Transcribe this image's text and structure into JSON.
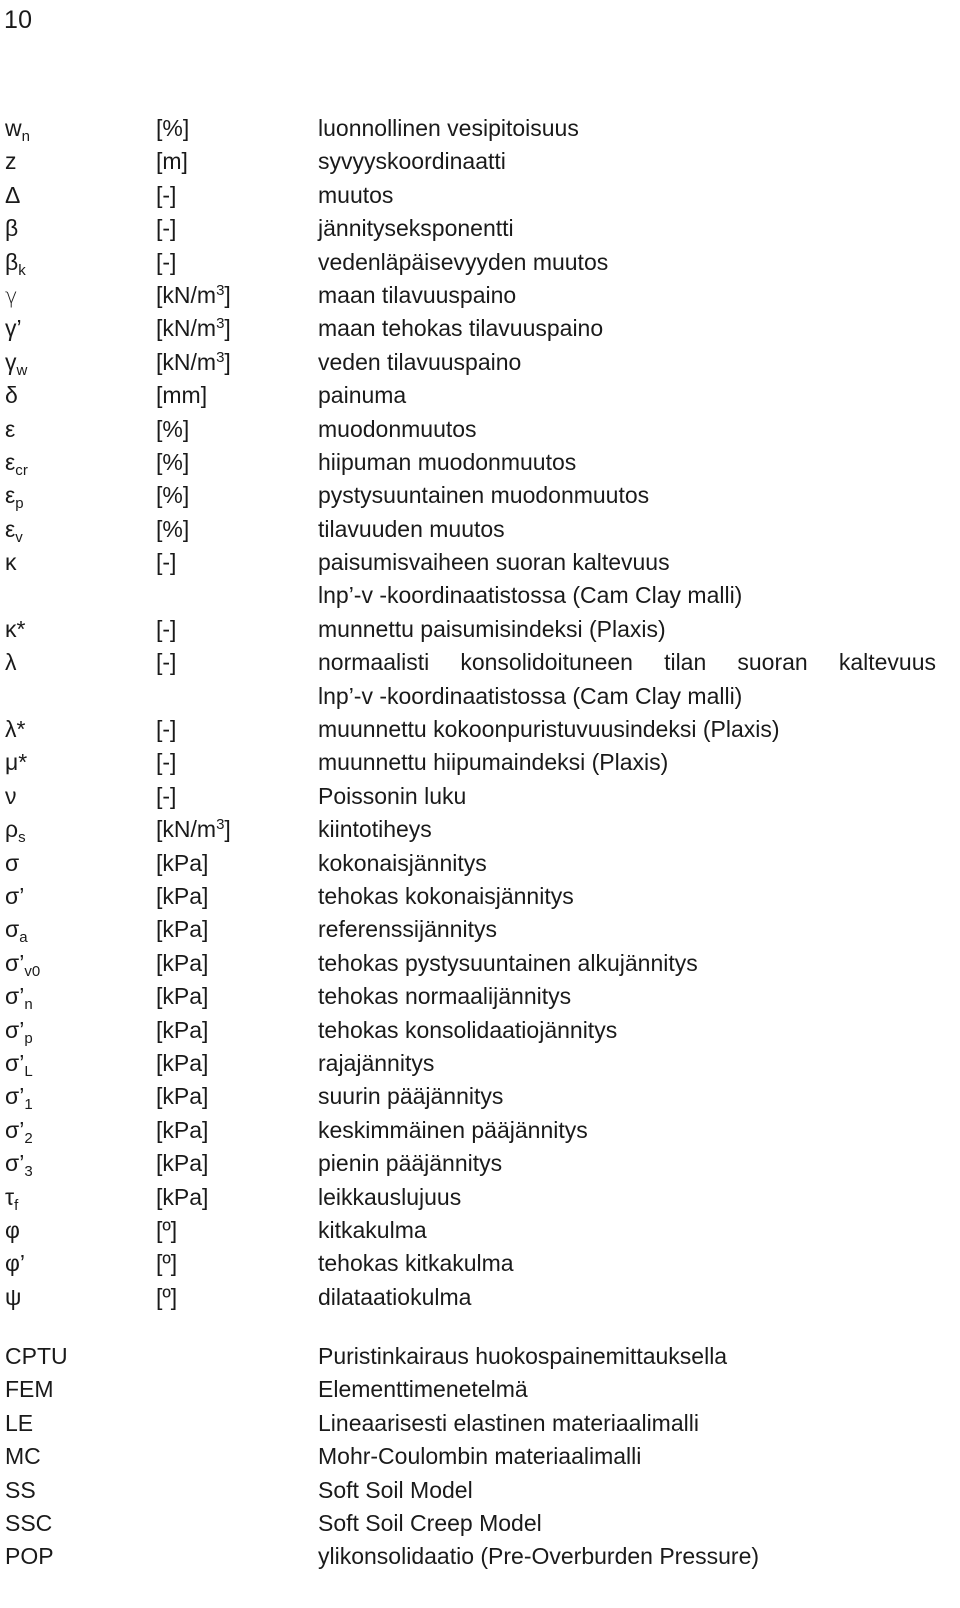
{
  "page": {
    "number": "10"
  },
  "symbols": [
    {
      "symbol": "w",
      "sub": "n",
      "unit": "[%]",
      "desc": "luonnollinen vesipitoisuus"
    },
    {
      "symbol": "z",
      "sub": "",
      "unit": "[m]",
      "desc": "syvyyskoordinaatti"
    },
    {
      "symbol": "Δ",
      "sub": "",
      "unit": "[-]",
      "desc": "muutos"
    },
    {
      "symbol": "β",
      "sub": "",
      "unit": "[-]",
      "desc": "jännityseksponentti"
    },
    {
      "symbol": "β",
      "sub": "k",
      "unit": "[-]",
      "desc": "vedenläpäisevyyden muutos"
    },
    {
      "symbol": "γ",
      "sub": "",
      "unit": "[kN/m³]",
      "desc": "maan tilavuuspaino",
      "style": "thin"
    },
    {
      "symbol": "γ’",
      "sub": "",
      "unit": "[kN/m³]",
      "desc": "maan tehokas tilavuuspaino"
    },
    {
      "symbol": "γ",
      "sub": "w",
      "unit": "[kN/m³]",
      "desc": "veden tilavuuspaino"
    },
    {
      "symbol": "δ",
      "sub": "",
      "unit": "[mm]",
      "desc": "painuma"
    },
    {
      "symbol": "ε",
      "sub": "",
      "unit": "[%]",
      "desc": "muodonmuutos"
    },
    {
      "symbol": "ε",
      "sub": "cr",
      "unit": "[%]",
      "desc": "hiipuman muodonmuutos"
    },
    {
      "symbol": "ε",
      "sub": "p",
      "unit": "[%]",
      "desc": "pystysuuntainen muodonmuutos"
    },
    {
      "symbol": "ε",
      "sub": "v",
      "unit": "[%]",
      "desc": "tilavuuden muutos"
    },
    {
      "symbol": "κ",
      "sub": "",
      "unit": "[-]",
      "desc": "paisumisvaiheen suoran kaltevuus"
    },
    {
      "symbol": "",
      "sub": "",
      "unit": "",
      "desc": "lnp’-v -koordinaatistossa (Cam Clay malli)"
    },
    {
      "symbol": "κ*",
      "sub": "",
      "unit": "[-]",
      "desc": "munnettu paisumisindeksi (Plaxis)"
    },
    {
      "symbol": "λ",
      "sub": "",
      "unit": "[-]",
      "desc": "normaalisti konsolidoituneen tilan suoran kaltevuus",
      "justify": true
    },
    {
      "symbol": "",
      "sub": "",
      "unit": "",
      "desc": "lnp’-v -koordinaatistossa (Cam Clay malli)"
    },
    {
      "symbol": "λ*",
      "sub": "",
      "unit": "[-]",
      "desc": "muunnettu kokoonpuristuvuusindeksi (Plaxis)"
    },
    {
      "symbol": "μ*",
      "sub": "",
      "unit": "[-]",
      "desc": "muunnettu hiipumaindeksi (Plaxis)"
    },
    {
      "symbol": "ν",
      "sub": "",
      "unit": "[-]",
      "desc": "Poissonin luku"
    },
    {
      "symbol": "ρ",
      "sub": "s",
      "unit": "[kN/m³]",
      "desc": "kiintotiheys"
    },
    {
      "symbol": "σ",
      "sub": "",
      "unit": "[kPa]",
      "desc": "kokonaisjännitys"
    },
    {
      "symbol": "σ’",
      "sub": "",
      "unit": "[kPa]",
      "desc": "tehokas kokonaisjännitys"
    },
    {
      "symbol": "σ",
      "sub": "a",
      "unit": "[kPa]",
      "desc": "referenssijännitys"
    },
    {
      "symbol": "σ’",
      "sub": "v0",
      "unit": "[kPa]",
      "desc": "tehokas pystysuuntainen alkujännitys"
    },
    {
      "symbol": "σ’",
      "sub": "n",
      "unit": "[kPa]",
      "desc": "tehokas normaalijännitys"
    },
    {
      "symbol": "σ’",
      "sub": "p",
      "unit": "[kPa]",
      "desc": "tehokas konsolidaatiojännitys"
    },
    {
      "symbol": "σ’",
      "sub": "L",
      "unit": "[kPa]",
      "desc": "rajajännitys"
    },
    {
      "symbol": "σ’",
      "sub": "1",
      "unit": "[kPa]",
      "desc": "suurin pääjännitys"
    },
    {
      "symbol": "σ’",
      "sub": "2",
      "unit": "[kPa]",
      "desc": "keskimmäinen pääjännitys"
    },
    {
      "symbol": "σ’",
      "sub": "3",
      "unit": "[kPa]",
      "desc": "pienin pääjännitys"
    },
    {
      "symbol": "τ",
      "sub": "f",
      "unit": "[kPa]",
      "desc": "leikkauslujuus"
    },
    {
      "symbol": "φ",
      "sub": "",
      "unit": "[º]",
      "desc": "kitkakulma"
    },
    {
      "symbol": "φ’",
      "sub": "",
      "unit": "[º]",
      "desc": "tehokas kitkakulma"
    },
    {
      "symbol": "ψ",
      "sub": "",
      "unit": "[º]",
      "desc": "dilataatiokulma"
    }
  ],
  "abbreviations": [
    {
      "abbr": "CPTU",
      "desc": "Puristinkairaus huokospainemittauksella"
    },
    {
      "abbr": "FEM",
      "desc": "Elementtimenetelmä"
    },
    {
      "abbr": "LE",
      "desc": "Lineaarisesti elastinen materiaalimalli"
    },
    {
      "abbr": "MC",
      "desc": "Mohr-Coulombin materiaalimalli"
    },
    {
      "abbr": "SS",
      "desc": "Soft Soil Model"
    },
    {
      "abbr": "SSC",
      "desc": "Soft Soil Creep Model"
    },
    {
      "abbr": "POP",
      "desc": "ylikonsolidaatio (Pre-Overburden Pressure)"
    }
  ]
}
